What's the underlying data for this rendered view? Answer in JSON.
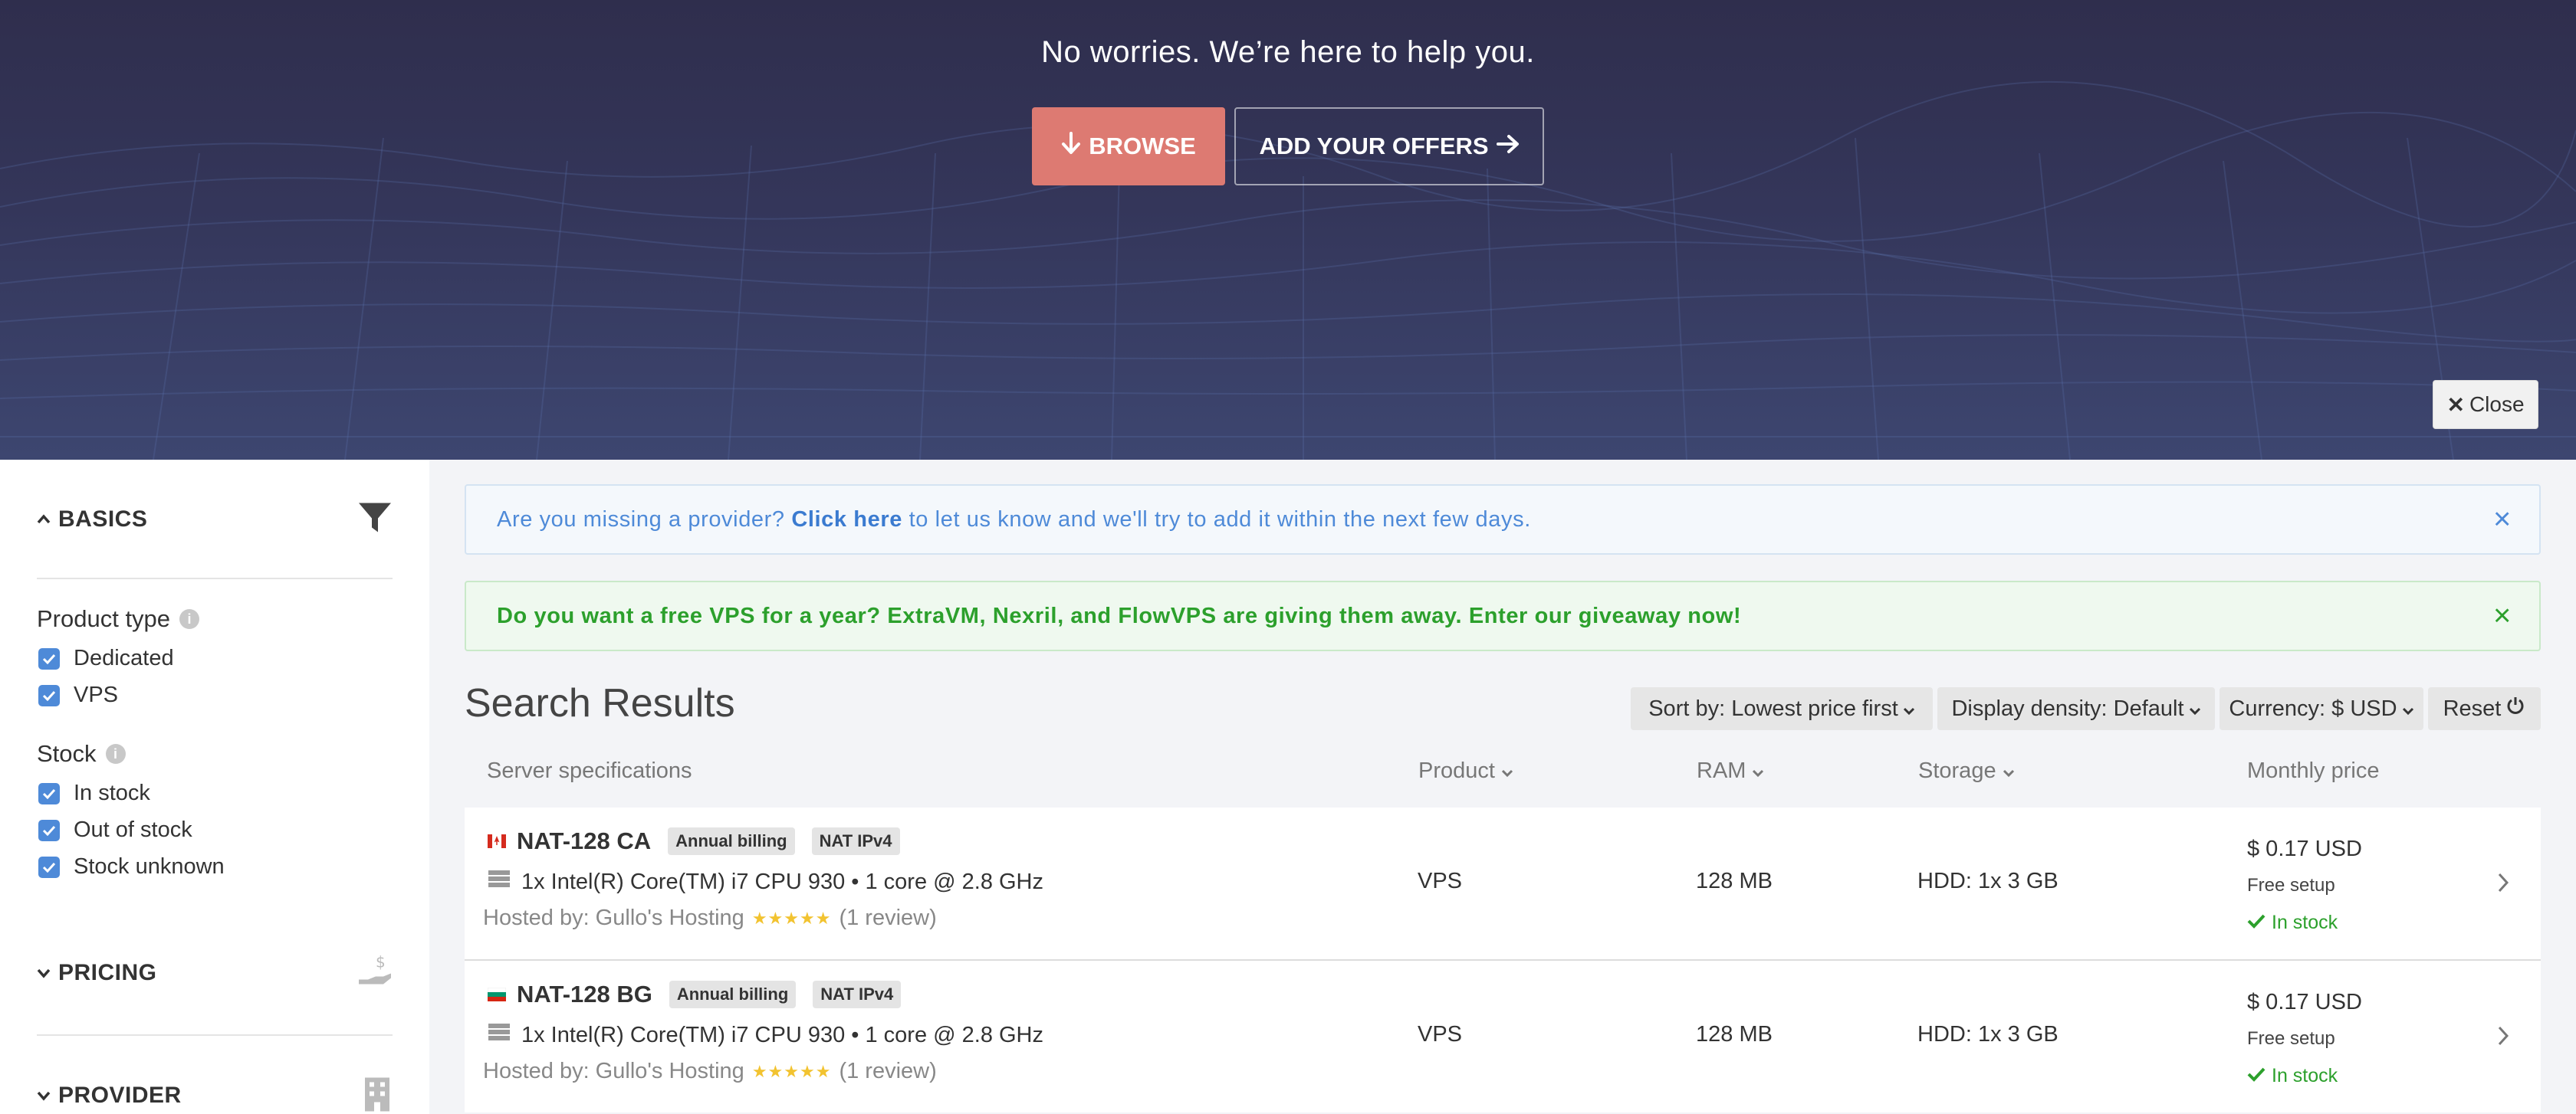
{
  "hero": {
    "title": "No worries. We’re here to help you.",
    "browse_label": "BROWSE",
    "offers_label": "ADD YOUR OFFERS",
    "close_label": "Close"
  },
  "sidebar": {
    "basics": "BASICS",
    "product_type": "Product type",
    "product_options": [
      "Dedicated",
      "VPS"
    ],
    "stock": "Stock",
    "stock_options": [
      "In stock",
      "Out of stock",
      "Stock unknown"
    ],
    "pricing": "PRICING",
    "provider": "PROVIDER"
  },
  "alerts": {
    "missing_prefix": "Are you missing a provider?",
    "missing_link": "Click here",
    "missing_suffix": "to let us know and we'll try to add it within the next few days.",
    "giveaway": "Do you want a free VPS for a year? ExtraVM, Nexril, and FlowVPS are giving them away. Enter our giveaway now!"
  },
  "results": {
    "title": "Search Results",
    "sort": "Sort by: Lowest price first",
    "density": "Display density: Default",
    "currency": "Currency: $ USD",
    "reset": "Reset"
  },
  "columns": {
    "spec": "Server specifications",
    "product": "Product",
    "ram": "RAM",
    "storage": "Storage",
    "price": "Monthly price"
  },
  "rows": [
    {
      "name": "NAT-128 CA",
      "tags": [
        "Annual billing",
        "NAT IPv4"
      ],
      "cpu": "1x Intel(R) Core(TM) i7 CPU 930 • 1 core @ 2.8 GHz",
      "host": "Hosted by: Gullo's Hosting",
      "stars": "★★★★★",
      "reviews": "(1 review)",
      "product": "VPS",
      "ram": "128 MB",
      "storage": "HDD: 1x 3 GB",
      "price": "$ 0.17 USD",
      "setup": "Free setup",
      "stock": "In stock"
    },
    {
      "name": "NAT-128 BG",
      "tags": [
        "Annual billing",
        "NAT IPv4"
      ],
      "cpu": "1x Intel(R) Core(TM) i7 CPU 930 • 1 core @ 2.8 GHz",
      "host": "Hosted by: Gullo's Hosting",
      "stars": "★★★★★",
      "reviews": "(1 review)",
      "product": "VPS",
      "ram": "128 MB",
      "storage": "HDD: 1x 3 GB",
      "price": "$ 0.17 USD",
      "setup": "Free setup",
      "stock": "In stock"
    }
  ],
  "colors": {
    "hero_bg": "#2f2e4d",
    "browse_btn": "#dd7a72",
    "link_blue": "#4e8ad8",
    "success_green": "#2ca02c",
    "star": "#f2c330"
  },
  "icons": {
    "filter": "filter-icon",
    "pricing": "hand-money-icon",
    "provider": "building-icon",
    "server": "server-icon",
    "check": "check-icon"
  }
}
